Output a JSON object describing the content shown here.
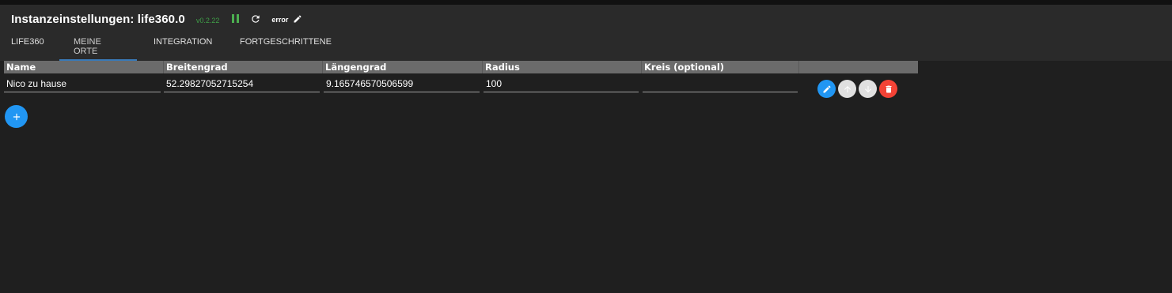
{
  "header": {
    "title": "Instanzeinstellungen: life360.0",
    "version": "v0.2.22",
    "status": "error",
    "icons": [
      "pause-icon",
      "refresh-icon",
      "edit-icon"
    ]
  },
  "tabs": [
    {
      "label": "LIFE360",
      "active": false
    },
    {
      "label": "MEINE ORTE",
      "active": true
    },
    {
      "label": "INTEGRATION",
      "active": false
    },
    {
      "label": "FORTGESCHRITTENE",
      "active": false
    }
  ],
  "table": {
    "columns": [
      "Name",
      "Breitengrad",
      "Längengrad",
      "Radius",
      "Kreis (optional)",
      ""
    ],
    "rows": [
      {
        "name": "Nico zu hause",
        "lat": "52.29827052715254",
        "lon": "9.165746570506599",
        "radius": "100",
        "circle": ""
      }
    ],
    "row_actions": [
      "edit-icon",
      "arrow-up-icon",
      "arrow-down-icon",
      "delete-icon"
    ]
  },
  "add_button": {
    "icon": "plus-icon"
  },
  "colors": {
    "background": "#1f1f1f",
    "header": "#2a2a2a",
    "table_header": "#6b6b6b",
    "accent_blue": "#2196f3",
    "version_green": "#3f9e47",
    "danger": "#f44336"
  }
}
